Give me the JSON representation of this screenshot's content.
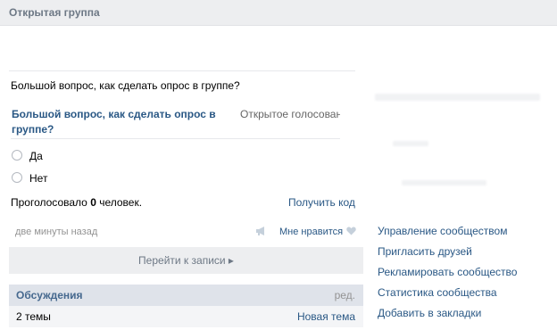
{
  "header": {
    "title": "Открытая группа"
  },
  "post": {
    "text": "Большой вопрос, как сделать опрос в группе?",
    "time": "две минуты назад",
    "like_label": "Мне нравится",
    "goto_label": "Перейти к записи ▸"
  },
  "poll": {
    "title": "Большой вопрос, как сделать опрос в группе?",
    "type": "Открытое голосование",
    "options": [
      "Да",
      "Нет"
    ],
    "voted_prefix": "Проголосовало ",
    "voted_count": "0",
    "voted_suffix": " человек.",
    "get_code": "Получить код"
  },
  "discussions": {
    "title": "Обсуждения",
    "edit": "ред.",
    "count": "2 темы",
    "new_topic": "Новая тема"
  },
  "sidebar": {
    "links": [
      "Управление сообществом",
      "Пригласить друзей",
      "Рекламировать сообщество",
      "Статистика сообщества",
      "Добавить в закладки"
    ]
  },
  "colors": {
    "link": "#2a5885",
    "header_bg": "#edeef0",
    "muted": "#939393"
  }
}
